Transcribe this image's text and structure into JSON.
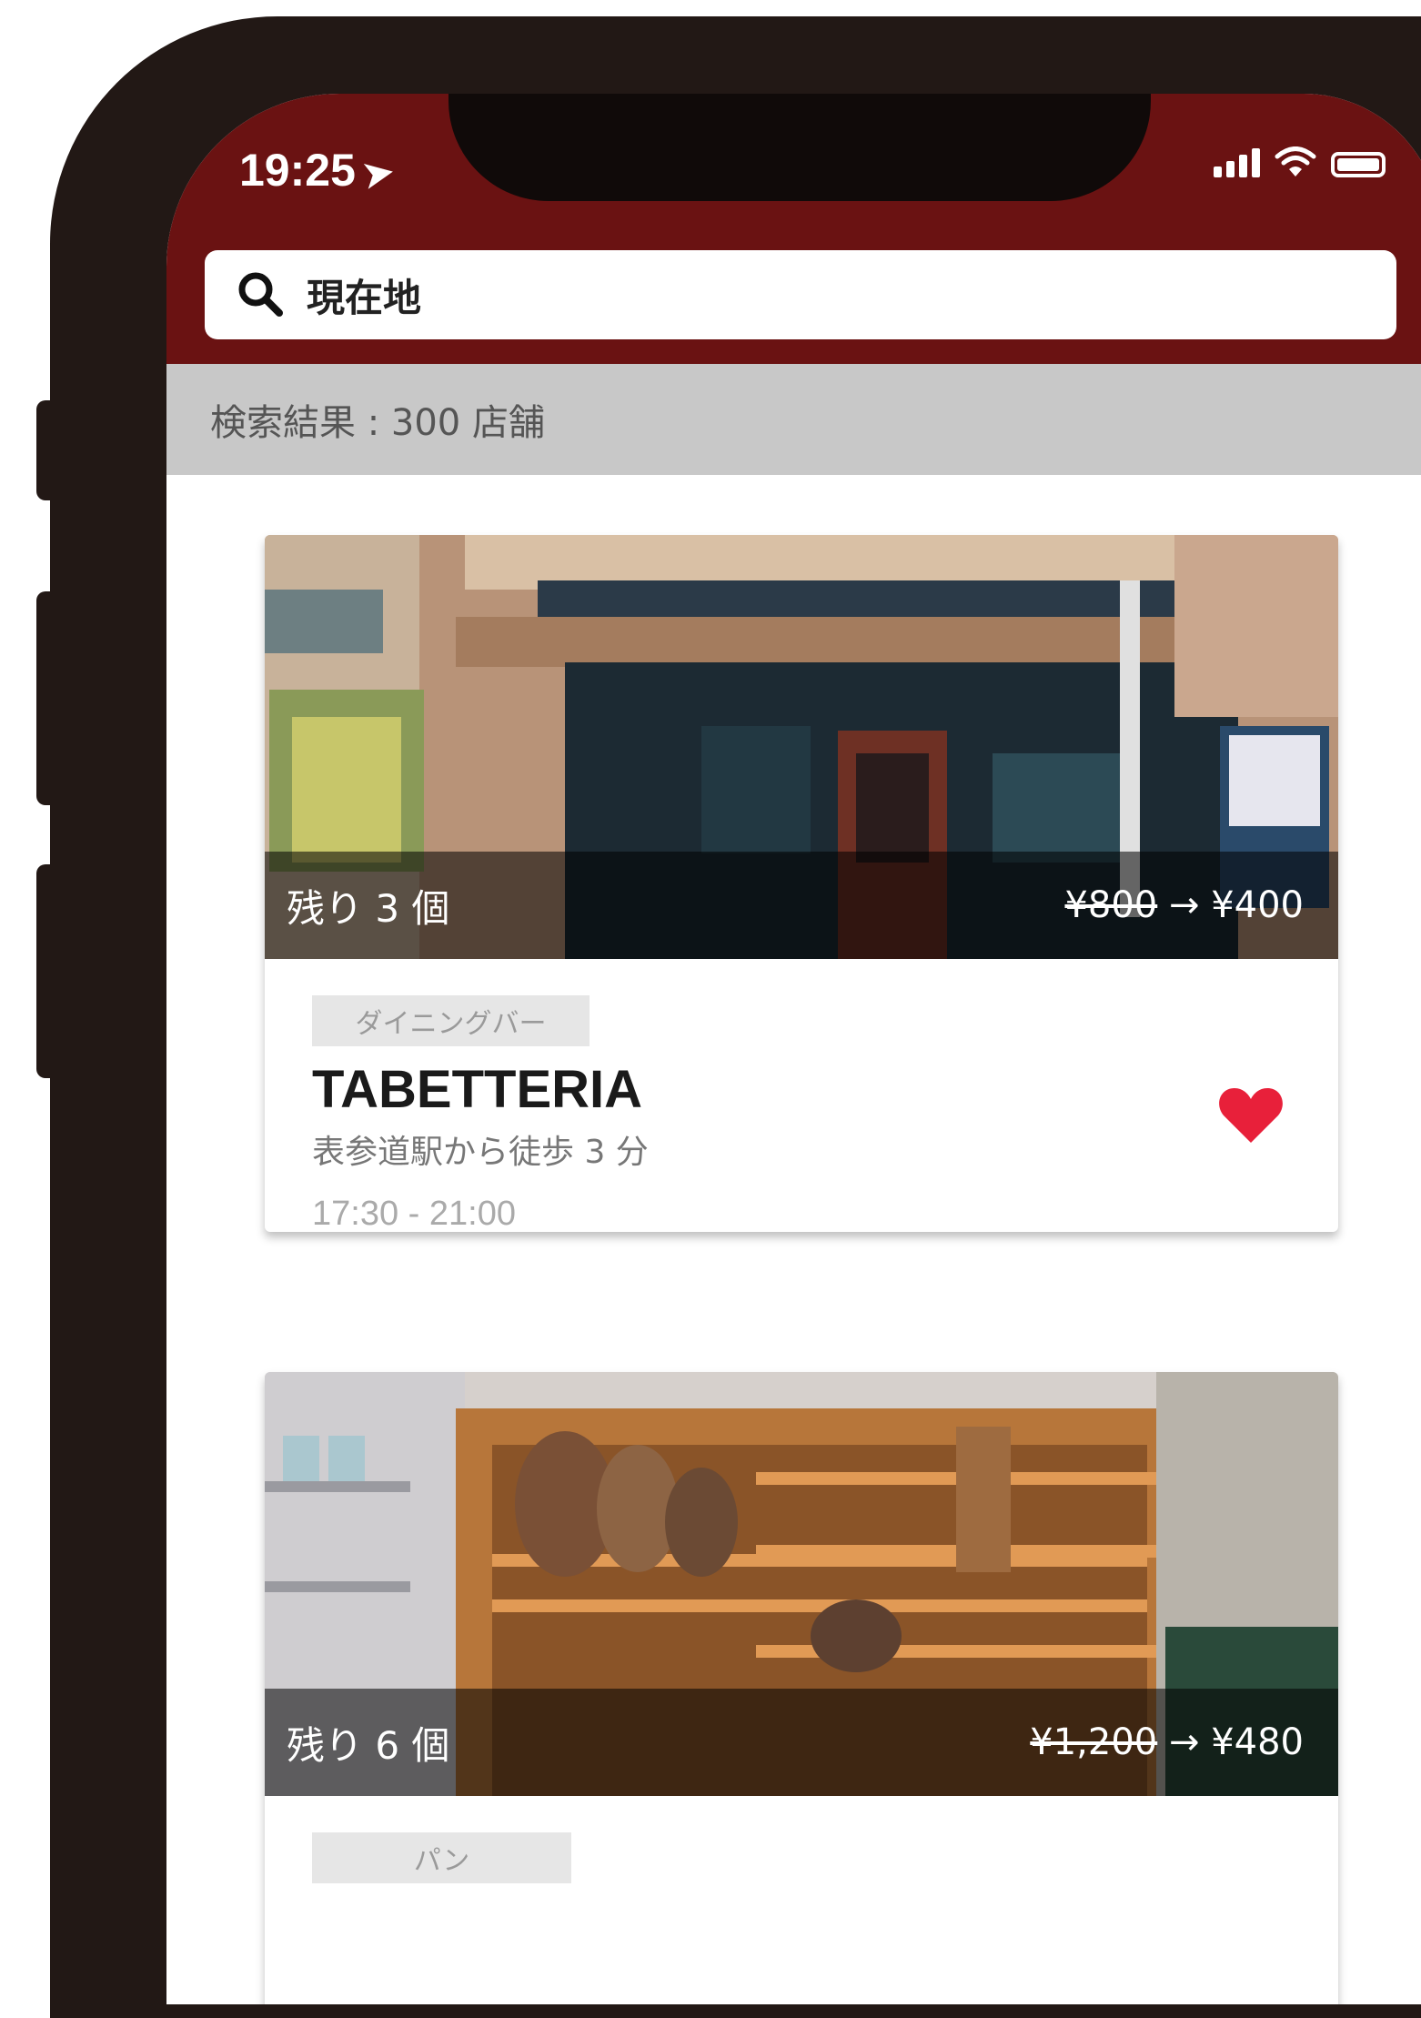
{
  "status_bar": {
    "time": "19:25",
    "location_arrow": "➤"
  },
  "search": {
    "query": "現在地"
  },
  "results": {
    "summary": "検索結果 : 300 店舗"
  },
  "colors": {
    "header": "#6a1212",
    "heart": "#e8203a",
    "frame": "#221815"
  },
  "cards": [
    {
      "stock": "残り 3 個",
      "price_old": "¥800",
      "arrow": "→",
      "price_new": "¥400",
      "category": "ダイニングバー",
      "name": "TABETTERIA",
      "access": "表参道駅から徒歩 3 分",
      "hours": "17:30 - 21:00",
      "favorite": true
    },
    {
      "stock": "残り 6 個",
      "price_old": "¥1,200",
      "arrow": "→",
      "price_new": "¥480",
      "category": "パン"
    }
  ]
}
